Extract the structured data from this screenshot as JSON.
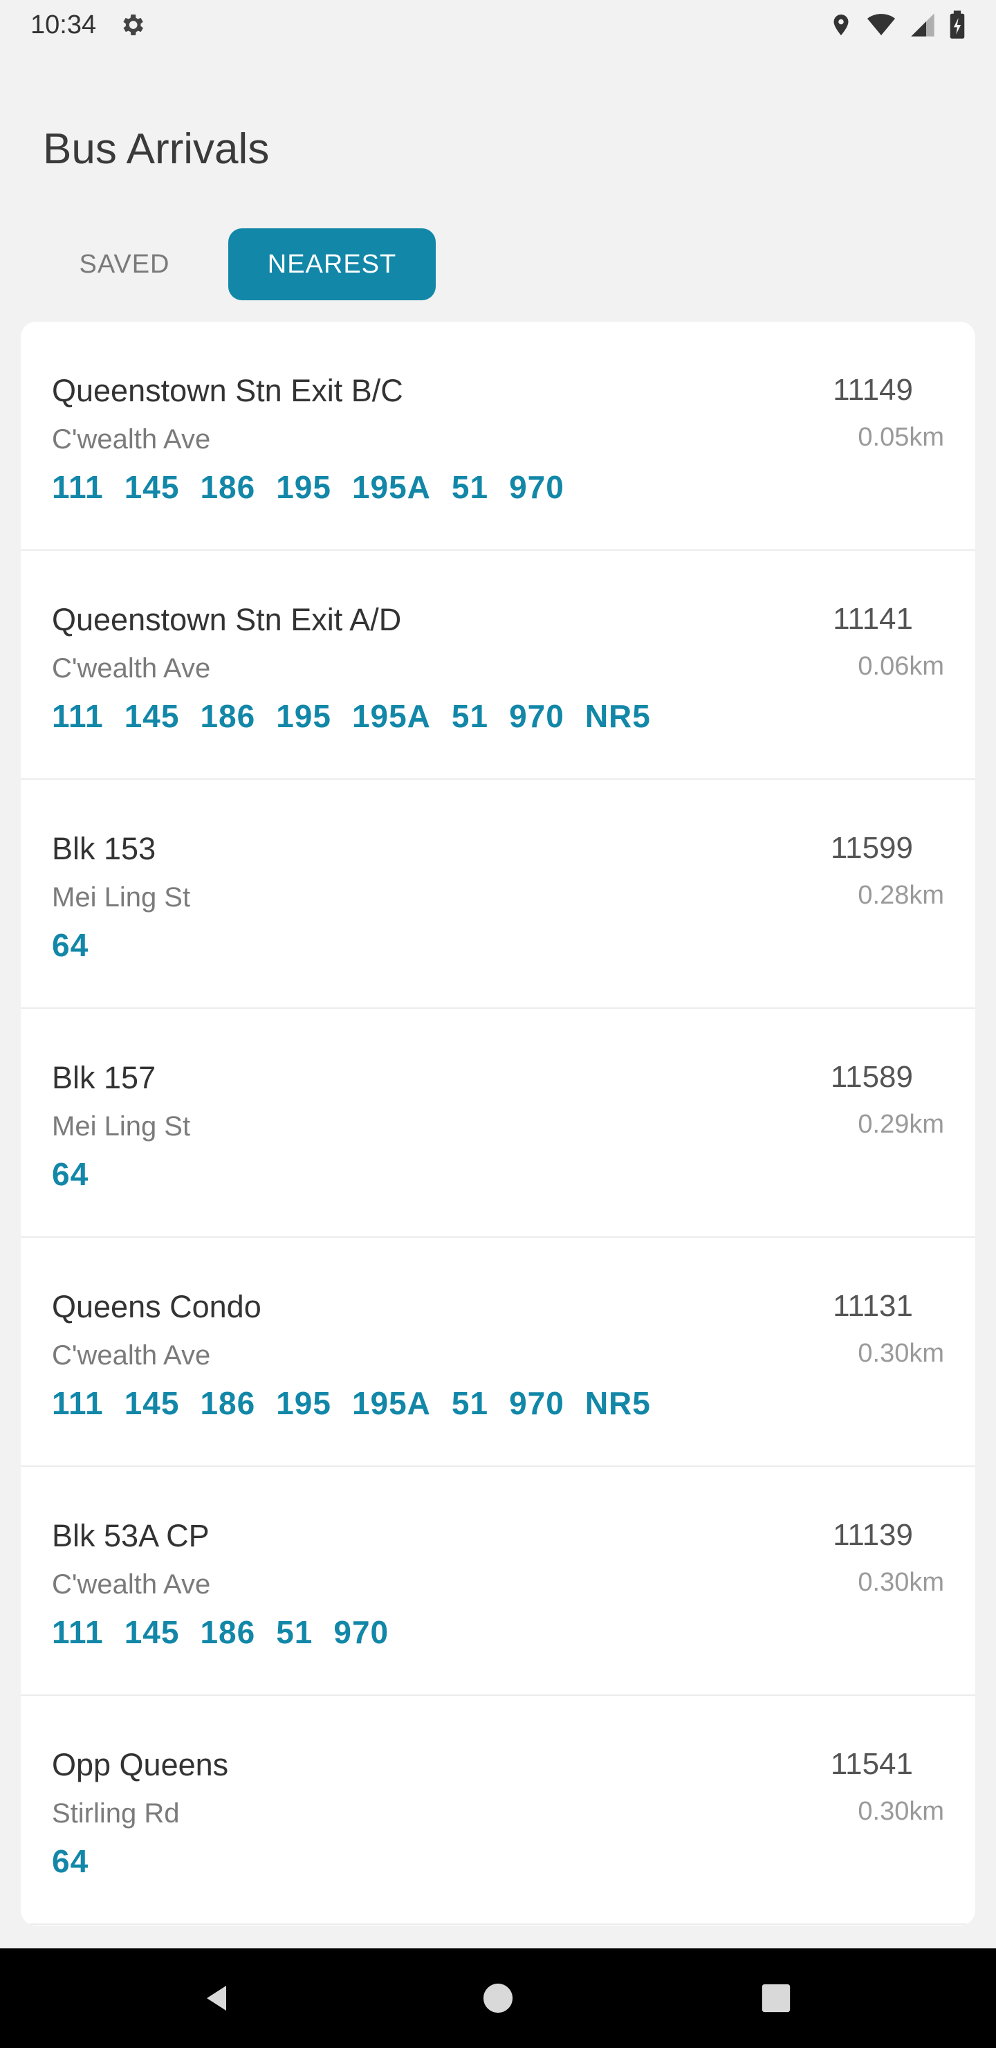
{
  "status_bar": {
    "time": "10:34",
    "icons": [
      "gear-icon",
      "location-icon",
      "wifi-icon",
      "cellular-icon",
      "battery-charging-icon"
    ]
  },
  "header": {
    "title": "Bus Arrivals"
  },
  "tabs": [
    {
      "label": "SAVED",
      "active": false
    },
    {
      "label": "NEAREST",
      "active": true
    }
  ],
  "colors": {
    "accent": "#1287a8",
    "background": "#f2f2f2",
    "card": "#ffffff"
  },
  "stops": [
    {
      "name": "Queenstown Stn Exit B/C",
      "road": "C'wealth Ave",
      "code": "11149",
      "distance": "0.05km",
      "routes": [
        "111",
        "145",
        "186",
        "195",
        "195A",
        "51",
        "970"
      ]
    },
    {
      "name": "Queenstown Stn Exit A/D",
      "road": "C'wealth Ave",
      "code": "11141",
      "distance": "0.06km",
      "routes": [
        "111",
        "145",
        "186",
        "195",
        "195A",
        "51",
        "970",
        "NR5"
      ]
    },
    {
      "name": "Blk 153",
      "road": "Mei Ling St",
      "code": "11599",
      "distance": "0.28km",
      "routes": [
        "64"
      ]
    },
    {
      "name": "Blk 157",
      "road": "Mei Ling St",
      "code": "11589",
      "distance": "0.29km",
      "routes": [
        "64"
      ]
    },
    {
      "name": "Queens Condo",
      "road": "C'wealth Ave",
      "code": "11131",
      "distance": "0.30km",
      "routes": [
        "111",
        "145",
        "186",
        "195",
        "195A",
        "51",
        "970",
        "NR5"
      ]
    },
    {
      "name": "Blk 53A CP",
      "road": "C'wealth Ave",
      "code": "11139",
      "distance": "0.30km",
      "routes": [
        "111",
        "145",
        "186",
        "51",
        "970"
      ]
    },
    {
      "name": "Opp Queens",
      "road": "Stirling Rd",
      "code": "11541",
      "distance": "0.30km",
      "routes": [
        "64"
      ]
    }
  ],
  "nav_bar": {
    "buttons": [
      "back-icon",
      "home-icon",
      "recents-icon"
    ]
  }
}
